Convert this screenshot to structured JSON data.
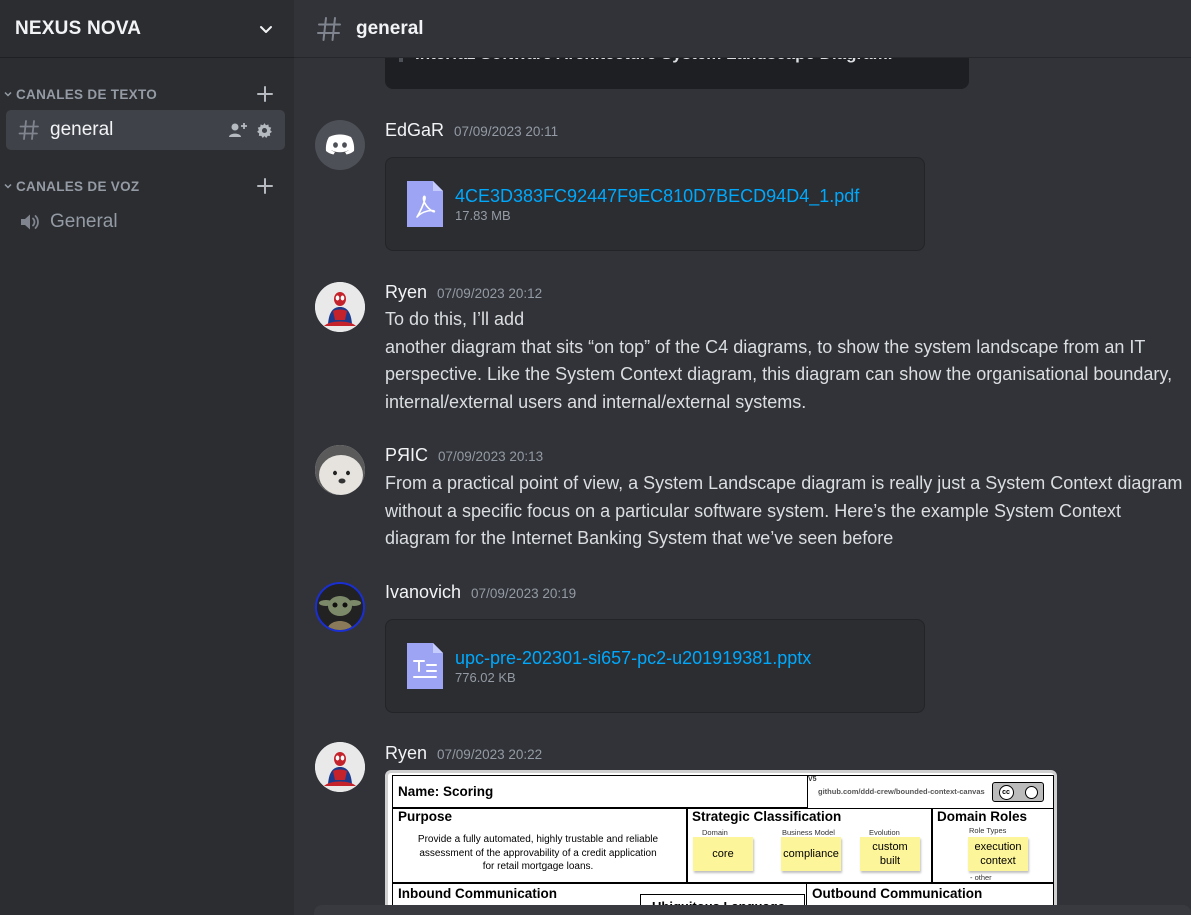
{
  "server": {
    "name": "NEXUS NOVA"
  },
  "sidebar": {
    "text_category": "CANALES DE TEXTO",
    "voice_category": "CANALES DE VOZ",
    "text_channels": [
      {
        "name": "general"
      }
    ],
    "voice_channels": [
      {
        "name": "General"
      }
    ]
  },
  "channel": {
    "name": "general"
  },
  "previous_embed": {
    "text": "Interfaz Software Architecture System Landscape Diagram."
  },
  "messages": [
    {
      "author": "EdGaR",
      "timestamp": "07/09/2023 20:11",
      "attachment": {
        "filename": "4CE3D383FC92447F9EC810D7BECD94D4_1.pdf",
        "size": "17.83 MB",
        "type": "pdf"
      }
    },
    {
      "author": "Ryen",
      "timestamp": "07/09/2023 20:12",
      "text": "To do this, I’ll add\nanother diagram that sits “on top” of the C4 diagrams, to show the system landscape from an IT perspective. Like the System Context diagram, this diagram can show the organisational boundary, internal/external users and internal/external systems."
    },
    {
      "author": "PЯIC",
      "timestamp": "07/09/2023 20:13",
      "text": "From a practical point of view, a System Landscape diagram is really just a System Context diagram without a specific focus on a particular software system. Here’s the example System Context diagram for the Internet Banking System that we’ve seen before"
    },
    {
      "author": "Ivanovich",
      "timestamp": "07/09/2023 20:19",
      "attachment": {
        "filename": "upc-pre-202301-si657-pc2-u201919381.pptx",
        "size": "776.02 KB",
        "type": "pptx"
      }
    },
    {
      "author": "Ryen",
      "timestamp": "07/09/2023 20:22",
      "image": {
        "name_label": "Name: Scoring",
        "version": "V5",
        "repo": "github.com/ddd-crew/bounded-context-canvas",
        "license": "cc by",
        "purpose_title": "Purpose",
        "purpose_text": "Provide a fully automated, highly trustable and reliable assessment of the approvability of a credit application for retail mortgage loans.",
        "strategic_title": "Strategic Classification",
        "strategic_cols": [
          "Domain",
          "Business Model",
          "Evolution"
        ],
        "strategic_stickies": [
          "core",
          "compliance",
          "custom\nbuilt"
        ],
        "roles_title": "Domain Roles",
        "roles_sub": "Role Types",
        "roles_sticky": "execution\ncontext",
        "roles_other": "- other",
        "inbound_title": "Inbound Communication",
        "ubiquitous_title": "Ubiquitous Language",
        "outbound_title": "Outbound Communication"
      }
    }
  ],
  "colors": {
    "sidebar_bg": "#2b2d31",
    "main_bg": "#313338",
    "link": "#00a8fc",
    "file_icon": "#9da4f4",
    "sticky": "#fdf59a"
  }
}
